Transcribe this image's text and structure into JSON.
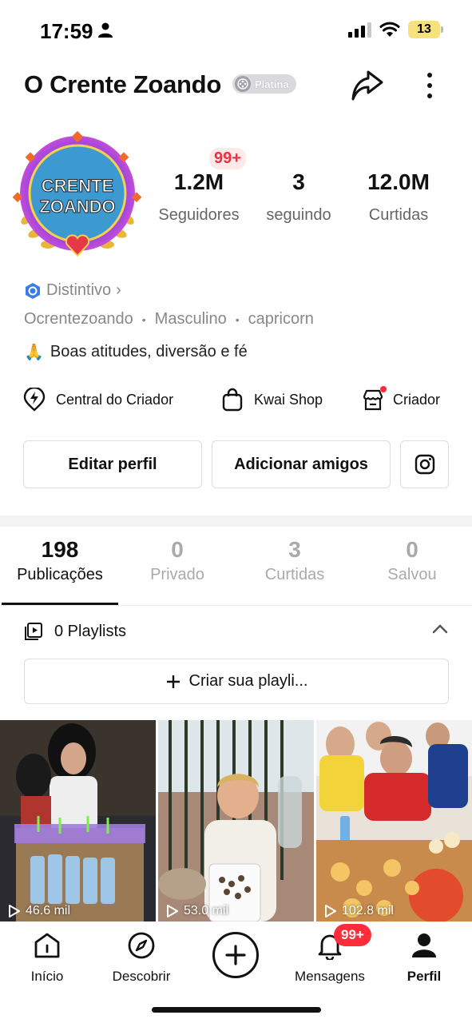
{
  "status_bar": {
    "time": "17:59",
    "battery": "13"
  },
  "header": {
    "title": "O Crente Zoando",
    "level_badge": "Platina"
  },
  "avatar": {
    "line1": "CRENTE",
    "line2": "ZOANDO"
  },
  "stats": {
    "notification_badge": "99+",
    "items": [
      {
        "value": "1.2M",
        "label": "Seguidores"
      },
      {
        "value": "3",
        "label": "seguindo"
      },
      {
        "value": "12.0M",
        "label": "Curtidas"
      }
    ]
  },
  "profile": {
    "distintivo": "Distintivo",
    "username": "Ocrentezoando",
    "gender": "Masculino",
    "sign": "capricorn",
    "bio_emoji": "🙏",
    "bio": "Boas atitudes, diversão e fé"
  },
  "tools": [
    {
      "label": "Central do Criador",
      "icon": "lightning-pin-icon"
    },
    {
      "label": "Kwai Shop",
      "icon": "shopping-bag-icon"
    },
    {
      "label": "Criador",
      "icon": "store-icon"
    }
  ],
  "actions": {
    "edit": "Editar perfil",
    "add_friends": "Adicionar amigos"
  },
  "tabs": [
    {
      "count": "198",
      "label": "Publicações"
    },
    {
      "count": "0",
      "label": "Privado"
    },
    {
      "count": "3",
      "label": "Curtidas"
    },
    {
      "count": "0",
      "label": "Salvou"
    }
  ],
  "playlists": {
    "label": "0 Playlists",
    "create": "Criar sua playli..."
  },
  "videos": [
    {
      "views": "46.6 mil"
    },
    {
      "views": "53.0 mil"
    },
    {
      "views": "102.8 mil"
    }
  ],
  "nav": {
    "items": [
      {
        "label": "Início"
      },
      {
        "label": "Descobrir"
      },
      {
        "label": "Mensagens"
      },
      {
        "label": "Perfil"
      }
    ],
    "messages_badge": "99+"
  }
}
